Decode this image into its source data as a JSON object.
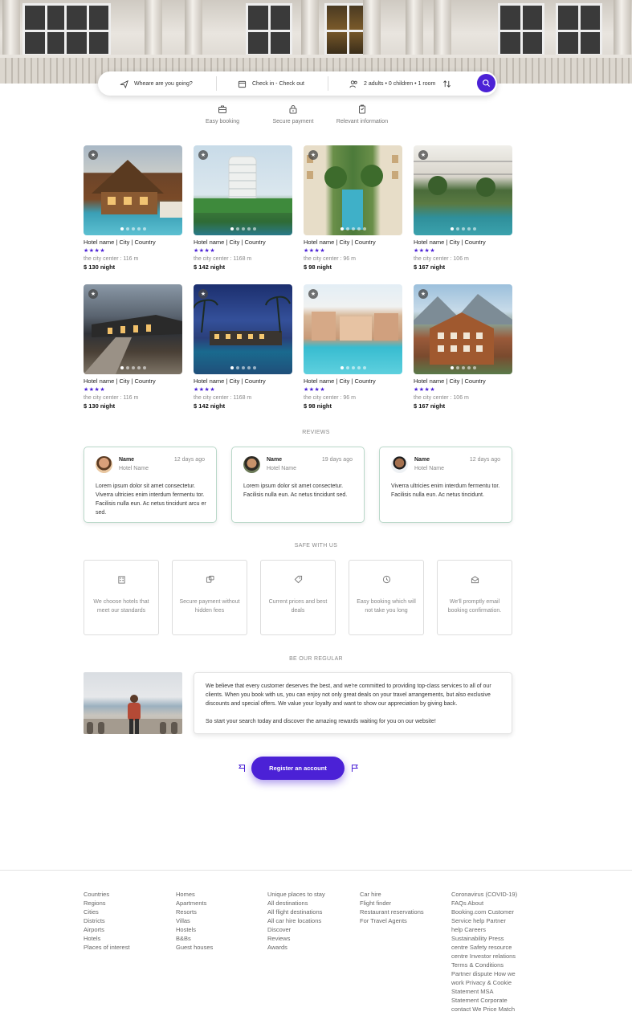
{
  "search": {
    "destination_placeholder": "Wheare are you going?",
    "dates": "Check in - Check out",
    "guests": "2 adults • 0 children • 1 room"
  },
  "features": [
    {
      "label": "Easy booking",
      "icon": "briefcase-icon"
    },
    {
      "label": "Secure payment",
      "icon": "lock-icon"
    },
    {
      "label": "Relevant information",
      "icon": "clipboard-icon"
    }
  ],
  "hotels": [
    {
      "name": "Hotel name | City | Country",
      "stars": "★★★★",
      "distance": "the city center : 116 m",
      "price": "$ 130 night"
    },
    {
      "name": "Hotel name | City | Country",
      "stars": "★★★★",
      "distance": "the city center : 1168 m",
      "price": "$ 142 night"
    },
    {
      "name": "Hotel name | City | Country",
      "stars": "★★★★",
      "distance": "the city center : 96 m",
      "price": "$ 98 night"
    },
    {
      "name": "Hotel name | City | Country",
      "stars": "★★★★",
      "distance": "the city center : 106 m",
      "price": "$ 167 night"
    },
    {
      "name": "Hotel name | City | Country",
      "stars": "★★★★",
      "distance": "the city center : 116 m",
      "price": "$ 130 night"
    },
    {
      "name": "Hotel name | City | Country",
      "stars": "★★★★",
      "distance": "the city center : 1168 m",
      "price": "$ 142 night"
    },
    {
      "name": "Hotel name | City | Country",
      "stars": "★★★★",
      "distance": "the city center : 96 m",
      "price": "$ 98 night"
    },
    {
      "name": "Hotel name | City | Country",
      "stars": "★★★★",
      "distance": "the city center : 106 m",
      "price": "$ 167 night"
    }
  ],
  "reviews_title": "REVIEWS",
  "reviews": [
    {
      "name": "Name",
      "hotel": "Hotel Name",
      "date": "12 days ago",
      "text": "Lorem ipsum dolor sit amet consectetur. Viverra ultricies enim interdum fermentu tor. Facilisis nulla eun. Ac netus tincidunt arcu er sed."
    },
    {
      "name": "Name",
      "hotel": "Hotel Name",
      "date": "19 days ago",
      "text": "Lorem ipsum dolor sit amet consectetur. Facilisis nulla eun. Ac netus tincidunt sed."
    },
    {
      "name": "Name",
      "hotel": "Hotel Name",
      "date": "12 days ago",
      "text": "Viverra ultricies enim interdum fermentu tor. Facilisis nulla eun. Ac netus tincidunt."
    }
  ],
  "safe_title": "SAFE WITH US",
  "safe": [
    {
      "text": "We choose hotels that meet our standards",
      "icon": "hotel-icon"
    },
    {
      "text": "Secure payment without hidden fees",
      "icon": "payment-icon"
    },
    {
      "text": "Current prices and best deals",
      "icon": "tag-icon"
    },
    {
      "text": "Easy booking which will not take you long",
      "icon": "clock-icon"
    },
    {
      "text": "We'll promptly email booking confirmation.",
      "icon": "mail-icon"
    }
  ],
  "regular_title": "BE OUR REGULAR",
  "regular_p1": "We believe that every customer deserves the best, and we're committed to providing top-class services to all of our clients. When you book with us, you can enjoy not only great deals on your travel arrangements, but also exclusive discounts and special offers. We value your loyalty and want to show our appreciation by giving back.",
  "regular_p2": "So start your search today and discover the amazing rewards waiting for you on our website!",
  "register_label": "Register an account",
  "footer": [
    [
      "Countries",
      "Regions",
      "Cities",
      "Districts",
      "Airports",
      "Hotels",
      "Places of interest"
    ],
    [
      "Homes",
      "Apartments",
      "Resorts",
      "Villas",
      "Hostels",
      "B&Bs",
      "Guest houses"
    ],
    [
      "Unique places to stay",
      "All destinations",
      "All flight destinations",
      "All car hire locations",
      "Discover",
      "Reviews",
      "Awards"
    ],
    [
      "Car hire",
      "Flight finder",
      "Restaurant reservations",
      "For Travel Agents"
    ],
    [
      "Coronavirus (COVID-19)",
      "FAQs About",
      "Booking.com Customer",
      "Service help Partner",
      "help Careers",
      "Sustainability Press",
      "centre Safety resource",
      "centre Investor relations",
      "Terms & Conditions",
      "Partner dispute How we",
      "work Privacy & Cookie",
      "Statement MSA",
      "Statement Corporate",
      "contact We Price Match"
    ]
  ],
  "colors": {
    "accent": "#4b21d6"
  }
}
